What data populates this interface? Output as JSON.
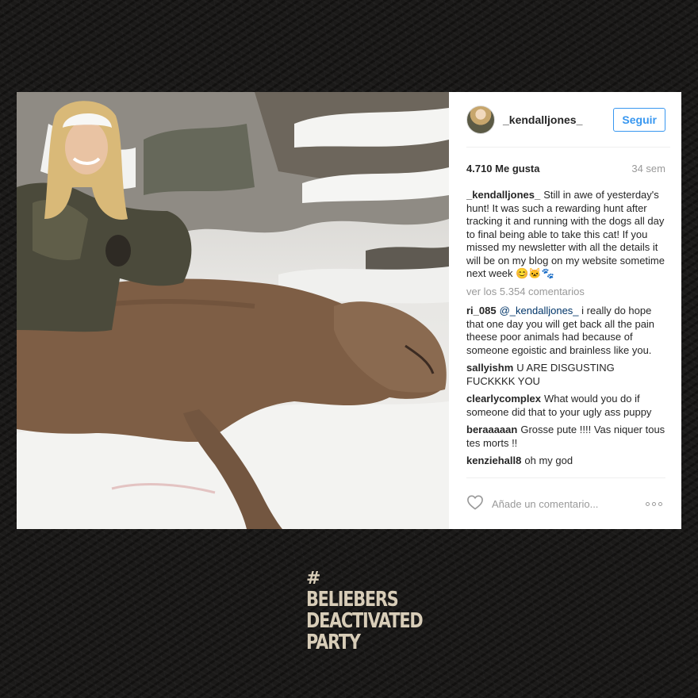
{
  "post": {
    "username": "_kendalljones_",
    "follow_label": "Seguir",
    "likes": "4.710 Me gusta",
    "age": "34 sem",
    "caption": {
      "author": "_kendalljones_",
      "text": "Still in awe of yesterday's hunt! It was such a rewarding hunt after tracking it and running with the dogs all day to final being able to take this cat! If you missed my newsletter with all the details it will be on my blog on my website sometime next week 😊🐱🐾"
    },
    "view_all_comments": "ver los 5.354 comentarios",
    "comments": [
      {
        "author": "ri_085",
        "mention": "@_kendalljones_",
        "text": "i really do hope that one day you will get back all the pain theese poor animals had because of someone egoistic and brainless like you."
      },
      {
        "author": "sallyishm",
        "mention": "",
        "text": "U ARE DISGUSTING FUCKKKK YOU"
      },
      {
        "author": "clearlycomplex",
        "mention": "",
        "text": "What would you do if someone did that to your ugly ass puppy"
      },
      {
        "author": "beraaaaan",
        "mention": "",
        "text": "Grosse pute !!!! Vas niquer tous tes morts !!"
      },
      {
        "author": "kenziehall8",
        "mention": "",
        "text": "oh my god"
      }
    ],
    "add_comment_placeholder": "Añade un comentario..."
  },
  "logo": {
    "hash": "#",
    "lines": [
      "BELIEBERS",
      "DEACTIVATED",
      "PARTY"
    ]
  },
  "colors": {
    "background": "#1b1a19",
    "follow_blue": "#3897f0",
    "logo_cream": "#d8cdb8"
  }
}
